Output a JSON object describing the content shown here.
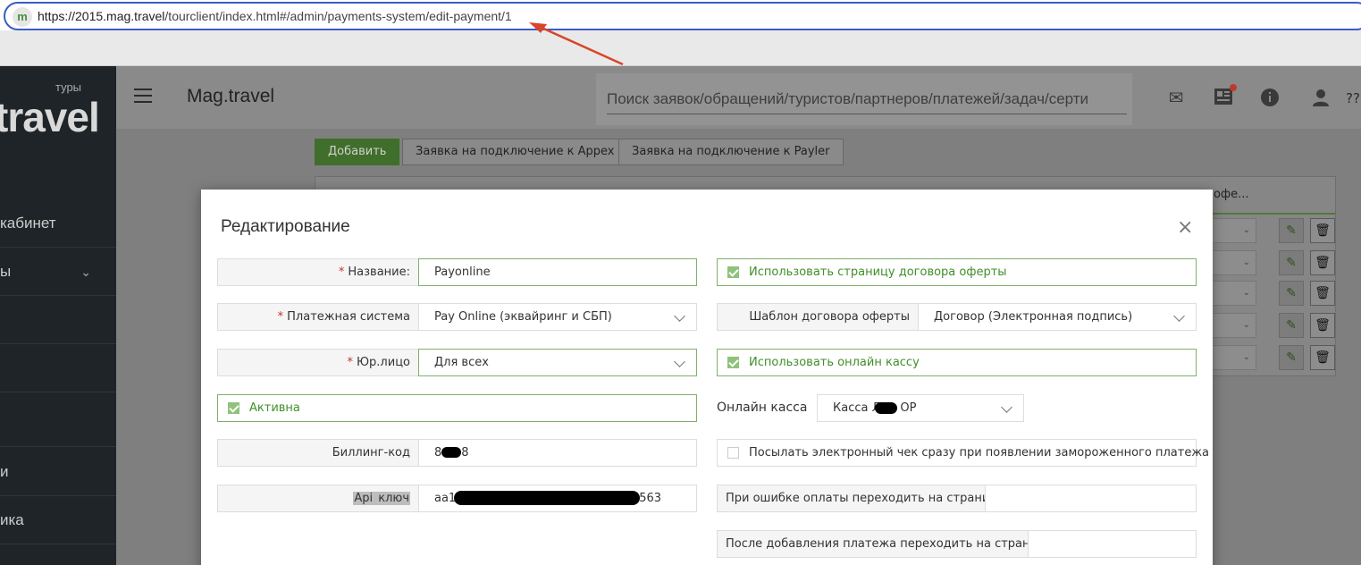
{
  "browser": {
    "url_host": "https://2015.mag.travel",
    "url_path": "/tourclient/index.html#/admin/payments-system/edit-payment/1",
    "favicon_letter": "m"
  },
  "sidebar": {
    "logo_small": "туры",
    "logo": "travel",
    "items": [
      {
        "label": "кабинет"
      },
      {
        "label": "ы"
      },
      {
        "label": ""
      },
      {
        "label": ""
      },
      {
        "label": ""
      },
      {
        "label": "и"
      },
      {
        "label": "ика"
      }
    ]
  },
  "header": {
    "title": "Mag.travel",
    "search_placeholder": "Поиск заявок/обращений/туристов/партнеров/платежей/задач/серти",
    "more": "??"
  },
  "toolbar": {
    "add": "Добавить",
    "appex": "Заявка на подключение к Appex",
    "payler": "Заявка на подключение к Payler"
  },
  "bg_table": {
    "header_fragment": "офе..."
  },
  "modal": {
    "title": "Редактирование",
    "close": "×",
    "name": {
      "label": "Название:",
      "value": "Payonline"
    },
    "payment_system": {
      "label": "Платежная система",
      "value": "Pay Online (эквайринг и СБП)"
    },
    "legal_entity": {
      "label": "Юр.лицо",
      "value": "Для всех"
    },
    "active": {
      "label": "Активна",
      "checked": true
    },
    "billing": {
      "label": "Биллинг-код",
      "value_start": "8",
      "value_end": "8"
    },
    "api_key": {
      "label_start": "Api",
      "label_end": " ключ",
      "value_start": "aa1",
      "value_end": "563"
    },
    "use_offer": {
      "label": "Использовать страницу договора оферты",
      "checked": true
    },
    "offer_template": {
      "label": "Шаблон договора оферты",
      "value": "Договор  (Электронная подпись)"
    },
    "use_kassa": {
      "label": "Использовать онлайн кассу",
      "checked": true
    },
    "online_kassa": {
      "label": "Онлайн касса",
      "value_start": "Касса Л",
      "value_end": "ОР"
    },
    "send_receipt": {
      "label": "Посылать электронный чек сразу при появлении замороженного платежа",
      "checked": false
    },
    "error_redirect": {
      "label": "При ошибке оплаты переходить на страницу",
      "value": ""
    },
    "after_add_redirect": {
      "label": "После добавления платежа переходить на страницу",
      "value": ""
    }
  },
  "colors": {
    "accent_green": "#7fb069",
    "text_green": "#3f8f2a",
    "url_border": "#3a5cc8",
    "annotation_arrow": "#d9452b",
    "required": "#c0392b"
  }
}
